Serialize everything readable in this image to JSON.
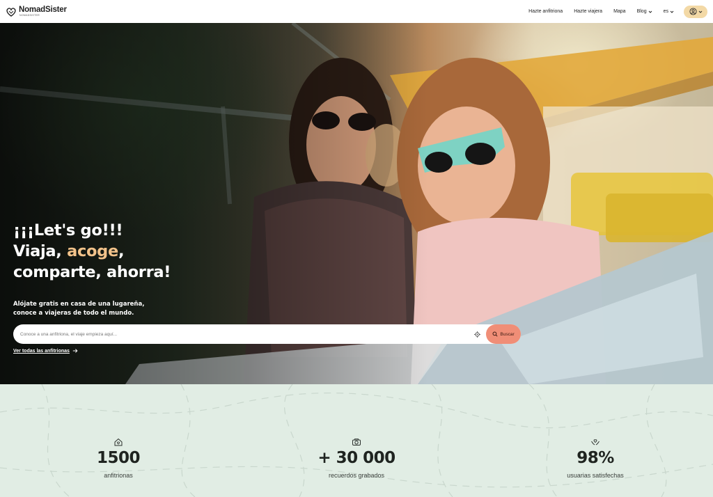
{
  "header": {
    "logo_name": "NomadSister",
    "logo_sub": "NOMADSISTER",
    "nav": [
      {
        "label": "Hazte anfitriona",
        "dropdown": false
      },
      {
        "label": "Hazte viajera",
        "dropdown": false
      },
      {
        "label": "Mapa",
        "dropdown": false
      },
      {
        "label": "Blog",
        "dropdown": true
      },
      {
        "label": "es",
        "dropdown": true
      }
    ],
    "account_icon": "user-circle-icon"
  },
  "hero": {
    "title_line1": "¡¡¡Let's go!!!",
    "title_line2_a": "Viaja, ",
    "title_line2_accent": "acoge",
    "title_line2_b": ",",
    "title_line3": "comparte, ahorra!",
    "subtitle_line1": "Alójate gratis en casa de una lugareña,",
    "subtitle_line2": "conoce a viajeras de todo el mundo.",
    "search_placeholder": "Conoce a una anfitriona, el viaje empieza aquí...",
    "search_button": "Buscar",
    "see_all_link": "Ver todas las anfitrionas"
  },
  "stats": [
    {
      "icon": "home-heart-icon",
      "value": "1500",
      "label": "anfitrionas"
    },
    {
      "icon": "camera-icon",
      "value": "+ 30 000",
      "label": "recuerdos grabados"
    },
    {
      "icon": "hands-heart-icon",
      "value": "98%",
      "label": "usuarias satisfechas"
    }
  ],
  "colors": {
    "accent": "#f2c28a",
    "search_button": "#f08e77",
    "account_button": "#f3d9a6",
    "stats_bg": "#e1ede4"
  }
}
